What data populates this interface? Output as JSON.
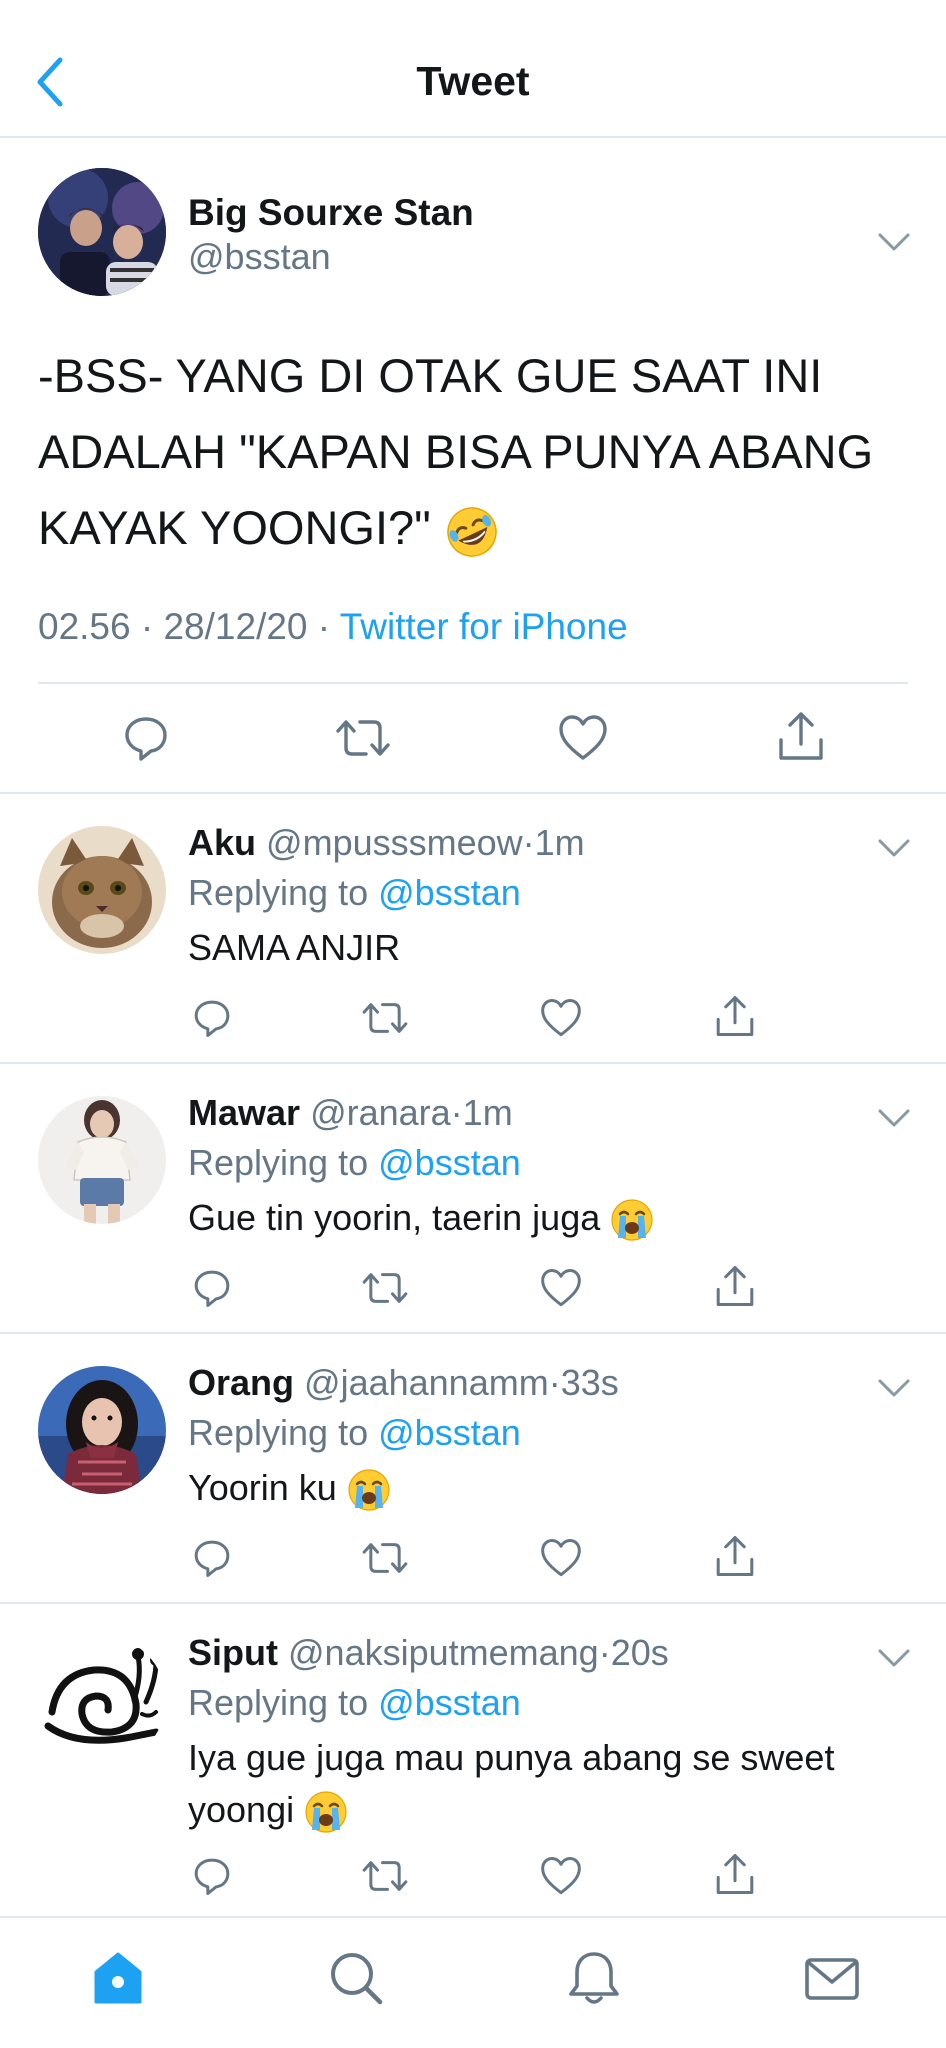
{
  "header": {
    "title": "Tweet",
    "back_icon": "chevron-left-icon"
  },
  "main_tweet": {
    "name": "Big Sourxe Stan",
    "handle": "@bsstan",
    "text": "-BSS- YANG DI OTAK GUE SAAT INI ADALAH \"KAPAN BISA PUNYA ABANG KAYAK YOONGI?\"",
    "emoji": "rolling-on-floor-laughing-emoji",
    "time": "02.56",
    "date": "28/12/20",
    "source": "Twitter for iPhone",
    "separator": "·"
  },
  "replies": [
    {
      "name": "Aku",
      "handle": "@mpusssmeow",
      "time": "1m",
      "replying_label": "Replying to",
      "replying_to": "@bsstan",
      "text": "SAMA ANJIR"
    },
    {
      "name": "Mawar",
      "handle": "@ranara",
      "time": "1m",
      "replying_label": "Replying to",
      "replying_to": "@bsstan",
      "text": "Gue tin yoorin, taerin juga",
      "emoji": "loudly-crying-emoji"
    },
    {
      "name": "Orang",
      "handle": "@jaahannamm",
      "time": "33s",
      "replying_label": "Replying to",
      "replying_to": "@bsstan",
      "text": "Yoorin ku",
      "emoji": "loudly-crying-emoji"
    },
    {
      "name": "Siput",
      "handle": "@naksiputmemang",
      "time": "20s",
      "replying_label": "Replying to",
      "replying_to": "@bsstan",
      "text": "Iya gue juga mau punya abang se sweet yoongi",
      "emoji": "loudly-crying-emoji"
    }
  ],
  "tabbar": [
    "home-icon",
    "search-icon",
    "notifications-icon",
    "messages-icon"
  ],
  "colors": {
    "accent": "#1da1f2",
    "text": "#14171a",
    "secondary": "#657786",
    "divider": "#e1e8ed"
  }
}
